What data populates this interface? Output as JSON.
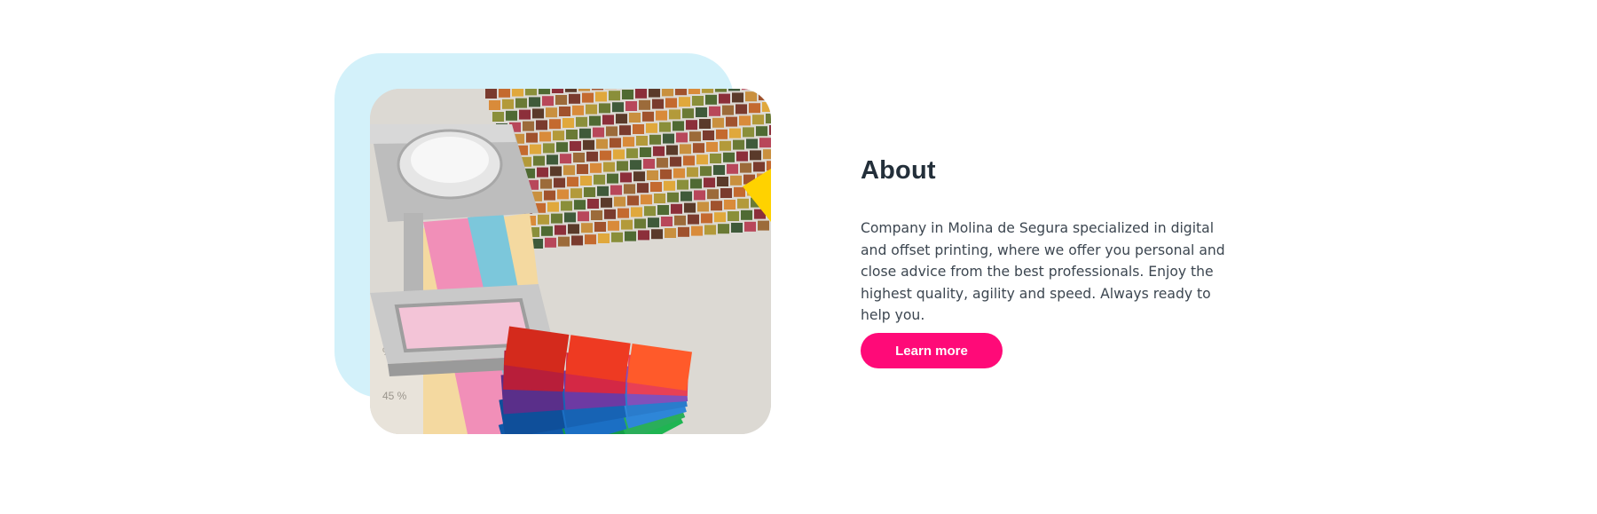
{
  "about": {
    "title": "About",
    "description": "Company in Molina de Segura specialized in digital and offset printing, where we offer you personal and close advice from the best professionals. Enjoy the highest quality, agility and speed. Always ready to help you.",
    "button_label": "Learn more"
  },
  "photo": {
    "subject": "color-swatches-and-loupe"
  },
  "colors": {
    "accent": "#ff0a78",
    "backdrop": "#d3f1fa",
    "heading": "#232f3a",
    "text": "#3c4650"
  }
}
